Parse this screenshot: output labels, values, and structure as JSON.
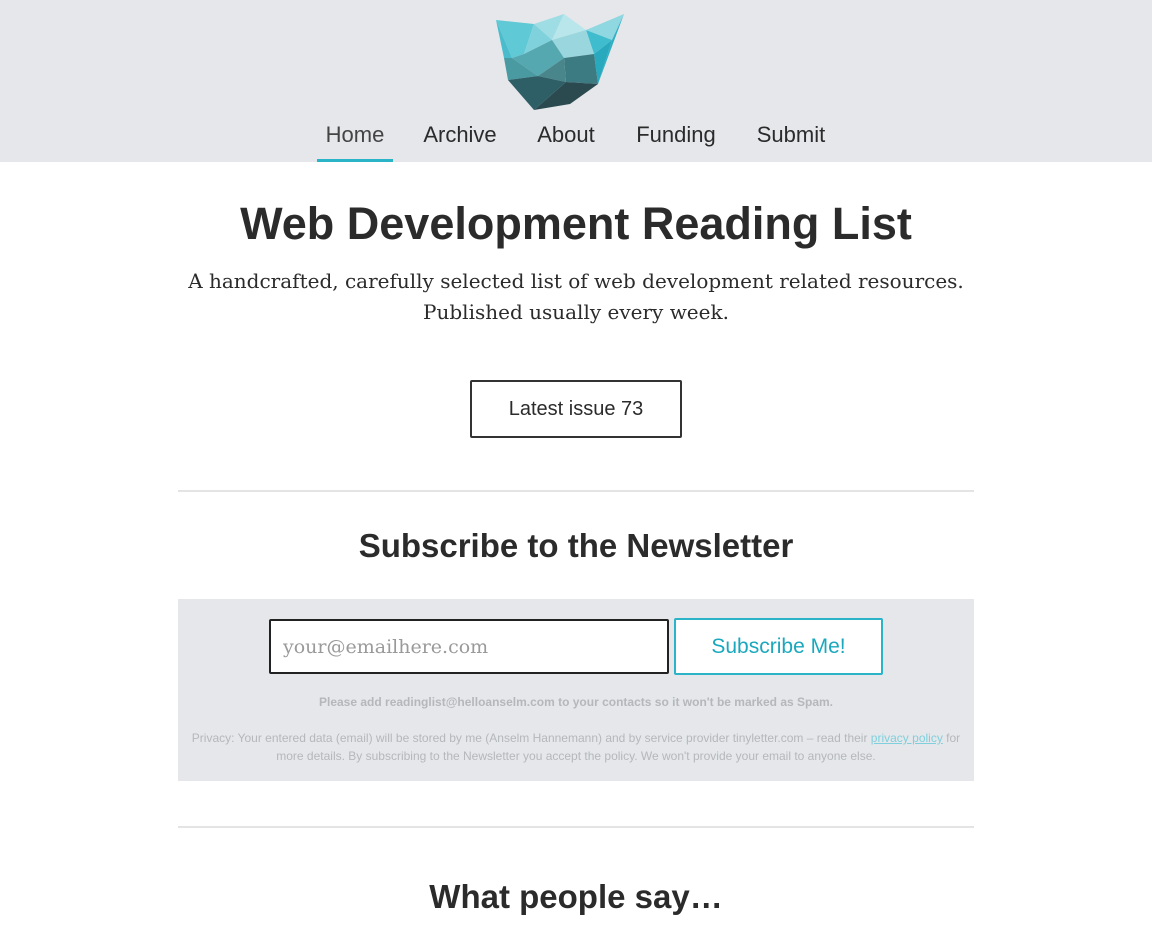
{
  "colors": {
    "header_bg": "#e5e7eb",
    "accent": "#2bb3c8",
    "text": "#2b2b2b",
    "muted": "#b5b7ba"
  },
  "logo": {
    "icon": "polygon-crown-logo"
  },
  "nav": {
    "items": [
      {
        "label": "Home",
        "active": true
      },
      {
        "label": "Archive",
        "active": false
      },
      {
        "label": "About",
        "active": false
      },
      {
        "label": "Funding",
        "active": false
      },
      {
        "label": "Submit",
        "active": false
      }
    ]
  },
  "hero": {
    "title": "Web Development Reading List",
    "subtitle_line1": "A handcrafted, carefully selected list of web development related resources.",
    "subtitle_line2": "Published usually every week.",
    "latest_button": "Latest issue 73"
  },
  "newsletter": {
    "title": "Subscribe to the Newsletter",
    "email_placeholder": "your@emailhere.com",
    "email_value": "",
    "subscribe_button": "Subscribe Me!",
    "spam_note": "Please add readinglist@helloanselm.com to your contacts so it won't be marked as Spam.",
    "privacy_prefix": "Privacy: Your entered data (email) will be stored by me (Anselm Hannemann) and by service provider tinyletter.com – read their",
    "privacy_link": "privacy policy",
    "privacy_suffix": "for more details. By subscribing to the Newsletter you accept the policy. We won't provide your email to anyone else."
  },
  "testimonials": {
    "title": "What people say…"
  }
}
